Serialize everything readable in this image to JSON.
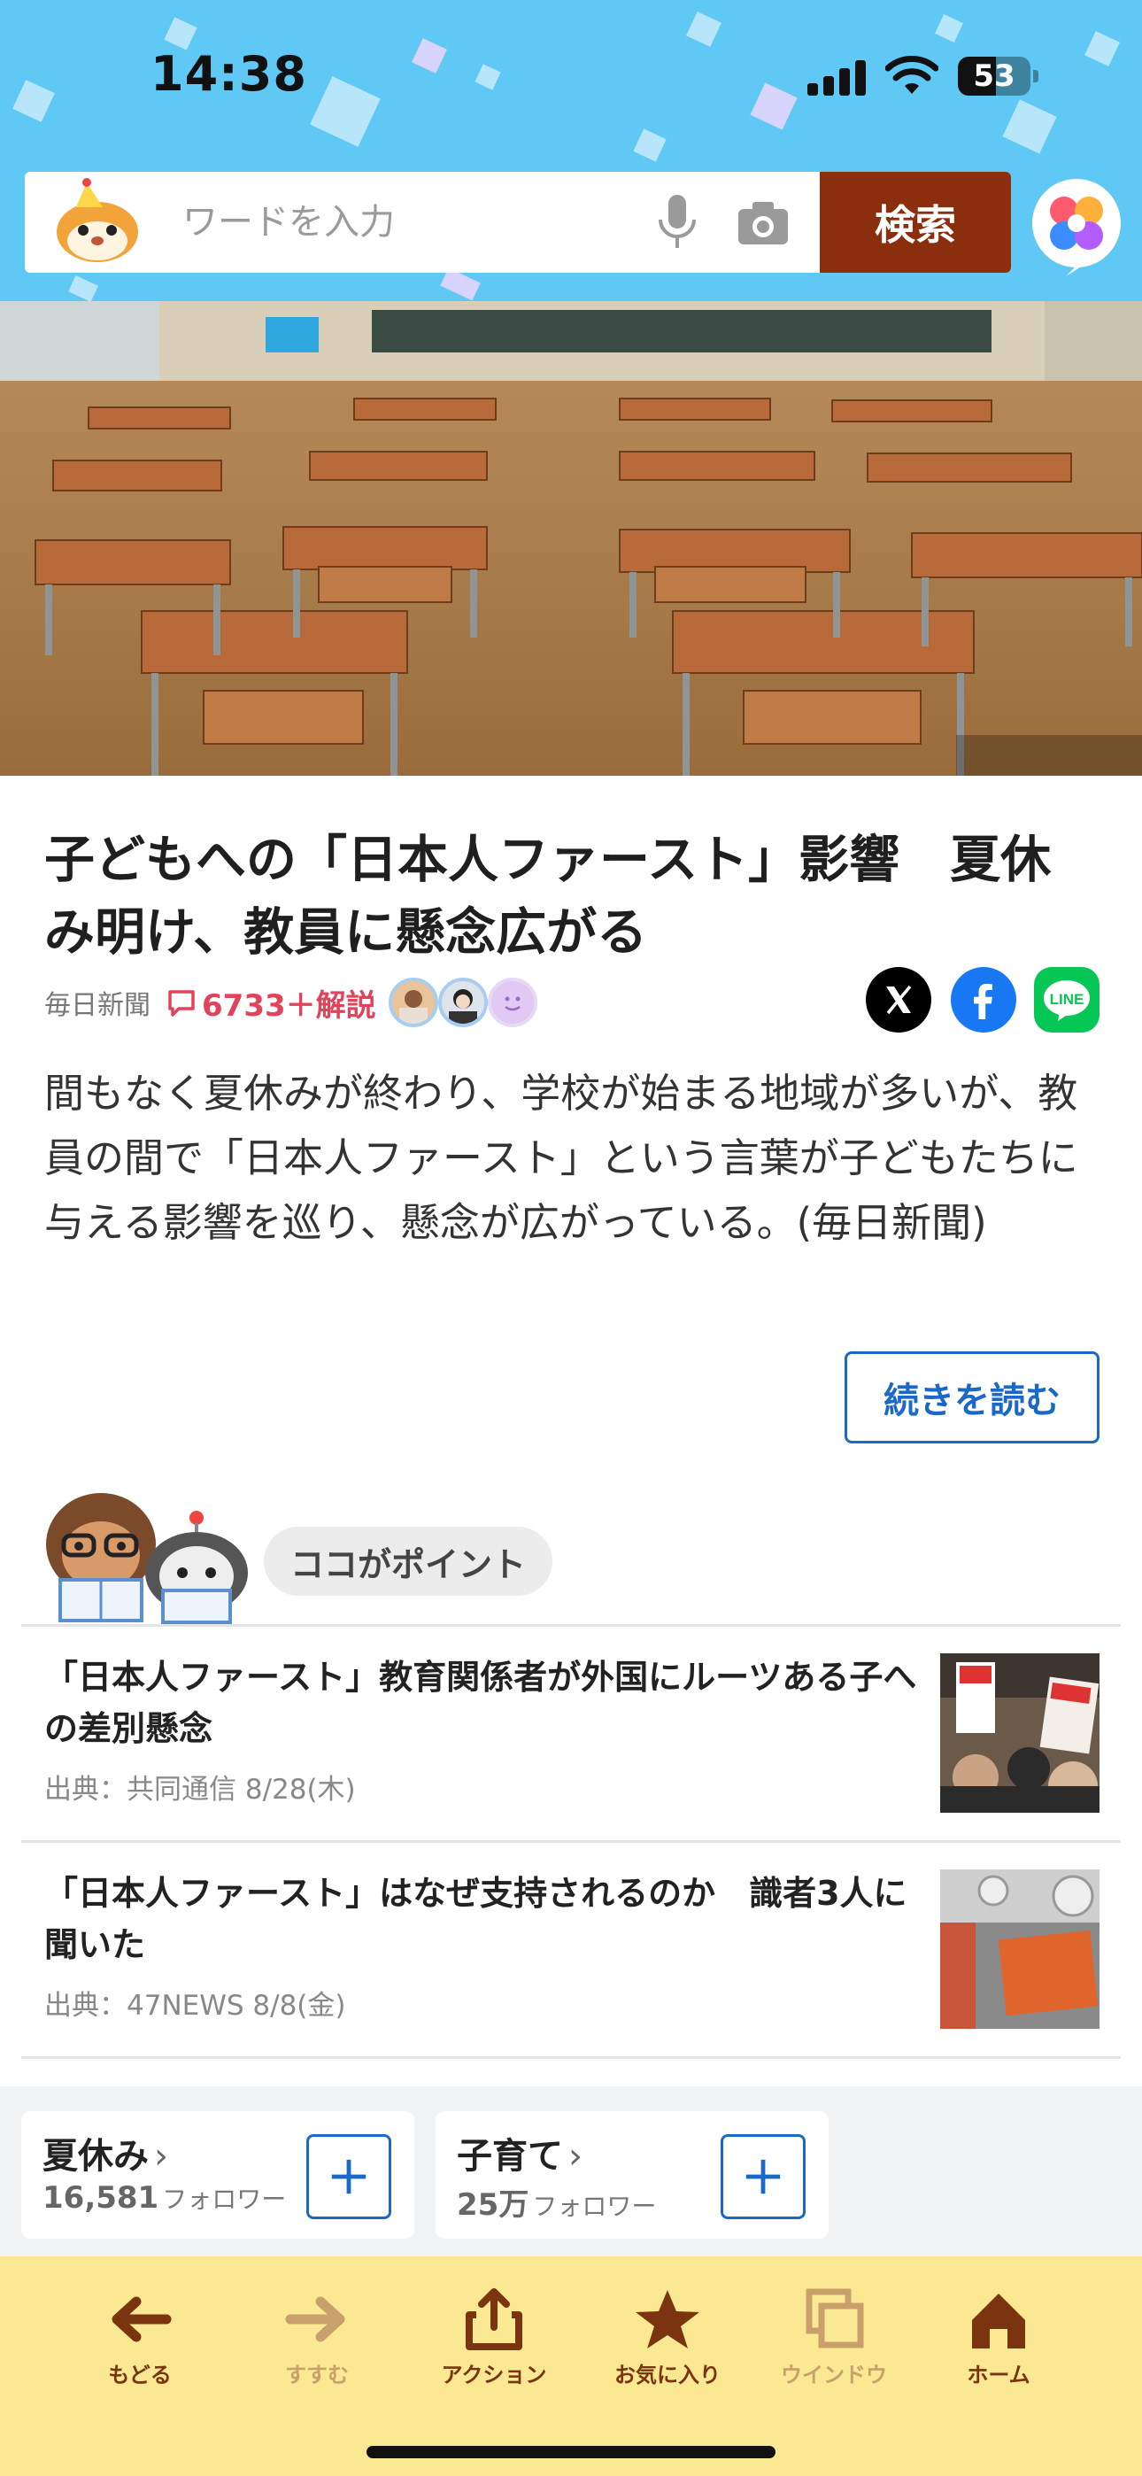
{
  "status_bar": {
    "time": "14:38",
    "battery_level": "53"
  },
  "search": {
    "placeholder": "ワードを入力",
    "button_label": "検索"
  },
  "article": {
    "headline": "子どもへの「日本人ファースト」影響　夏休み明け、教員に懸念広がる",
    "source": "毎日新聞",
    "comment_count": "6733＋解説",
    "summary": "間もなく夏休みが終わり、学校が始まる地域が多いが、教員の間で「日本人ファースト」という言葉が子どもたちに与える影響を巡り、懸念が広がっている。(毎日新聞)",
    "read_more_label": "続きを読む"
  },
  "point_section": {
    "label": "ココがポイント",
    "items": [
      {
        "title": "「日本人ファースト」教育関係者が外国にルーツある子への差別懸念",
        "source": "出典：共同通信  8/28(木)"
      },
      {
        "title": "「日本人ファースト」はなぜ支持されるのか　識者3人に聞いた",
        "source": "出典：47NEWS  8/8(金)"
      }
    ]
  },
  "follow_topics": [
    {
      "topic": "夏休み",
      "count": "16,581",
      "unit": "フォロワー"
    },
    {
      "topic": "子育て",
      "count": "25万",
      "unit": "フォロワー"
    }
  ],
  "toolbar": {
    "items": [
      {
        "label": "もどる",
        "icon": "arrow-left-icon",
        "enabled": true
      },
      {
        "label": "すすむ",
        "icon": "arrow-right-icon",
        "enabled": false
      },
      {
        "label": "アクション",
        "icon": "share-action-icon",
        "enabled": true
      },
      {
        "label": "お気に入り",
        "icon": "star-icon",
        "enabled": true
      },
      {
        "label": "ウインドウ",
        "icon": "window-icon",
        "enabled": false
      },
      {
        "label": "ホーム",
        "icon": "home-icon",
        "enabled": true
      }
    ]
  },
  "colors": {
    "header_bg": "#5fc8f4",
    "search_button": "#8b2e0d",
    "link_blue": "#1a68c7",
    "comment_red": "#e0435a",
    "toolbar_bg": "#fae992",
    "toolbar_icon": "#7a3410"
  }
}
